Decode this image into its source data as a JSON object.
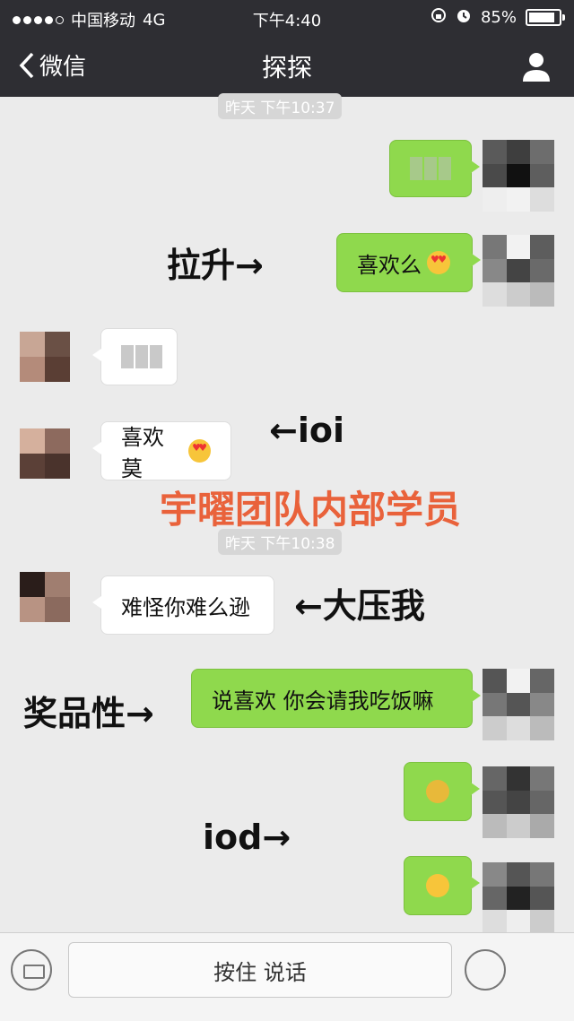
{
  "status_bar": {
    "carrier": "中国移动",
    "network": "4G",
    "time": "下午4:40",
    "battery_text": "85%",
    "battery_level": 0.85
  },
  "nav": {
    "back_label": "微信",
    "title": "探探"
  },
  "timestamps": [
    "昨天 下午10:37",
    "昨天 下午10:38"
  ],
  "messages": [
    {
      "side": "right",
      "text": ""
    },
    {
      "side": "right",
      "text": "喜欢么"
    },
    {
      "side": "left",
      "text": ""
    },
    {
      "side": "left",
      "text": "喜欢莫"
    },
    {
      "side": "left",
      "text": "难怪你难么逊"
    },
    {
      "side": "right",
      "text": "说喜欢 你会请我吃饭嘛"
    },
    {
      "side": "right",
      "text": ""
    },
    {
      "side": "right",
      "text": ""
    }
  ],
  "annotations": {
    "a1": "拉升→",
    "a2": "←ioi",
    "a3": "←大压我",
    "a4": "奖品性→",
    "a5": "iod→"
  },
  "watermark": "宇曜团队内部学员",
  "input": {
    "hold_to_talk": "按住 说话"
  },
  "icons": [
    "chevron-left-icon",
    "person-icon",
    "keyboard-icon",
    "emoji-icon",
    "lock-icon",
    "alarm-icon",
    "battery-icon"
  ],
  "colors": {
    "navbar": "#2e2e33",
    "sent_bubble": "#8fd94d",
    "received_bubble": "#ffffff",
    "watermark": "#e9623b",
    "background": "#ebebeb"
  }
}
